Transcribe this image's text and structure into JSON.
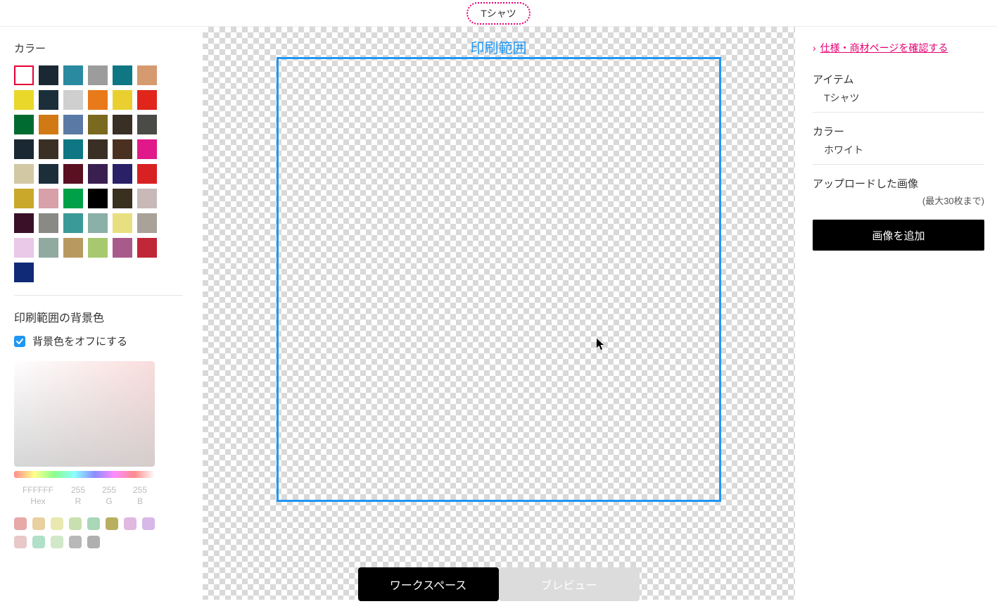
{
  "top_tab_label": "Tシャツ",
  "sidebar": {
    "color_section_label": "カラー",
    "colors": [
      {
        "hex": "#ffffff",
        "selected": true
      },
      {
        "hex": "#1a2833"
      },
      {
        "hex": "#2a8aa0"
      },
      {
        "hex": "#9c9c9c"
      },
      {
        "hex": "#0f7784"
      },
      {
        "hex": "#d59a70"
      },
      {
        "hex": "#e9d82a"
      },
      {
        "hex": "#1a2f3a"
      },
      {
        "hex": "#cfcfcf"
      },
      {
        "hex": "#e87a1a"
      },
      {
        "hex": "#e9d030"
      },
      {
        "hex": "#e0251b"
      },
      {
        "hex": "#006b31"
      },
      {
        "hex": "#d17a15"
      },
      {
        "hex": "#5a7aa5"
      },
      {
        "hex": "#7a6a20"
      },
      {
        "hex": "#3a2f24"
      },
      {
        "hex": "#4a4a46"
      },
      {
        "hex": "#1a2833"
      },
      {
        "hex": "#3a2f24"
      },
      {
        "hex": "#0f7784"
      },
      {
        "hex": "#3a2f24"
      },
      {
        "hex": "#4a3020"
      },
      {
        "hex": "#e0188a"
      },
      {
        "hex": "#d2c8a4"
      },
      {
        "hex": "#1a2f3a"
      },
      {
        "hex": "#5a1020"
      },
      {
        "hex": "#3a2050"
      },
      {
        "hex": "#2a2068"
      },
      {
        "hex": "#d82122"
      },
      {
        "hex": "#caa82a"
      },
      {
        "hex": "#d8a0a8"
      },
      {
        "hex": "#00a048"
      },
      {
        "hex": "#000000"
      },
      {
        "hex": "#3a3020"
      },
      {
        "hex": "#c8b8b8"
      },
      {
        "hex": "#3a1028"
      },
      {
        "hex": "#8a8a85"
      },
      {
        "hex": "#3a9a98"
      },
      {
        "hex": "#8ab0a8"
      },
      {
        "hex": "#e8e080"
      },
      {
        "hex": "#a8a298"
      },
      {
        "hex": "#eac8e8"
      },
      {
        "hex": "#90aaa0"
      },
      {
        "hex": "#b89a60"
      },
      {
        "hex": "#a8c870"
      },
      {
        "hex": "#a85a8a"
      },
      {
        "hex": "#c02838"
      },
      {
        "hex": "#102a78"
      }
    ],
    "bg_section_label": "印刷範囲の背景色",
    "bg_off_checkbox_label": "背景色をオフにする",
    "bg_off_checked": true,
    "picker": {
      "hex_val": "FFFFFF",
      "r_val": "255",
      "g_val": "255",
      "b_val": "255",
      "hex_label": "Hex",
      "r_label": "R",
      "g_label": "G",
      "b_label": "B"
    },
    "preset_row1": [
      "#e8a8a8",
      "#e8d0a0",
      "#e8e8b0",
      "#c8e0b0",
      "#a8d8b8",
      "#b8b060",
      "#e0b8e0",
      "#d8b8e8"
    ],
    "preset_row2": [
      "#e8c8c8",
      "#b0e0c8",
      "#d0e8c8",
      "#b8b8b8",
      "#b0b0b0"
    ]
  },
  "canvas": {
    "print_area_label": "印刷範囲",
    "workspace_btn": "ワークスペース",
    "preview_btn": "ブレビュー"
  },
  "right": {
    "spec_link": "仕様・商材ページを確認する",
    "item_label": "アイテム",
    "item_value": "Tシャツ",
    "color_label": "カラー",
    "color_value": "ホワイト",
    "upload_label": "アップロードした画像",
    "upload_limit": "(最大30枚まで)",
    "add_image_btn": "画像を追加"
  }
}
